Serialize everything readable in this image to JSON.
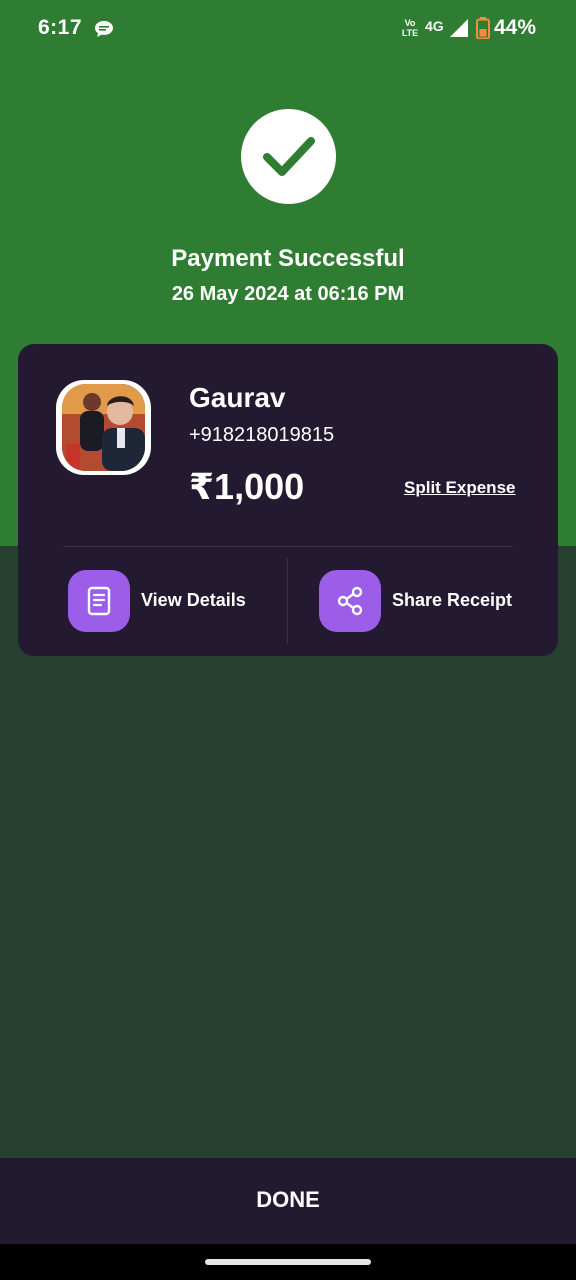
{
  "status_bar": {
    "time": "6:17",
    "volte_line1": "Vo",
    "volte_line2": "LTE",
    "network": "4G",
    "battery": "44%",
    "icons": [
      "chat-bubble-icon",
      "volte-icon",
      "signal-icon",
      "battery-icon"
    ]
  },
  "header": {
    "status_icon": "check-icon",
    "title": "Payment Successful",
    "datetime": "26 May 2024 at 06:16 PM"
  },
  "card": {
    "payee_name": "Gaurav",
    "payee_phone": "+918218019815",
    "amount": "₹1,000",
    "split_label": "Split Expense",
    "actions": [
      {
        "label": "View Details",
        "icon": "document-icon"
      },
      {
        "label": "Share Receipt",
        "icon": "share-icon"
      }
    ]
  },
  "footer": {
    "done_label": "DONE"
  },
  "colors": {
    "top_background": "#2e7d32",
    "bottom_background": "#25402f",
    "card_background": "#231a31",
    "action_accent": "#9c5ee8",
    "done_bar": "#221a30"
  }
}
